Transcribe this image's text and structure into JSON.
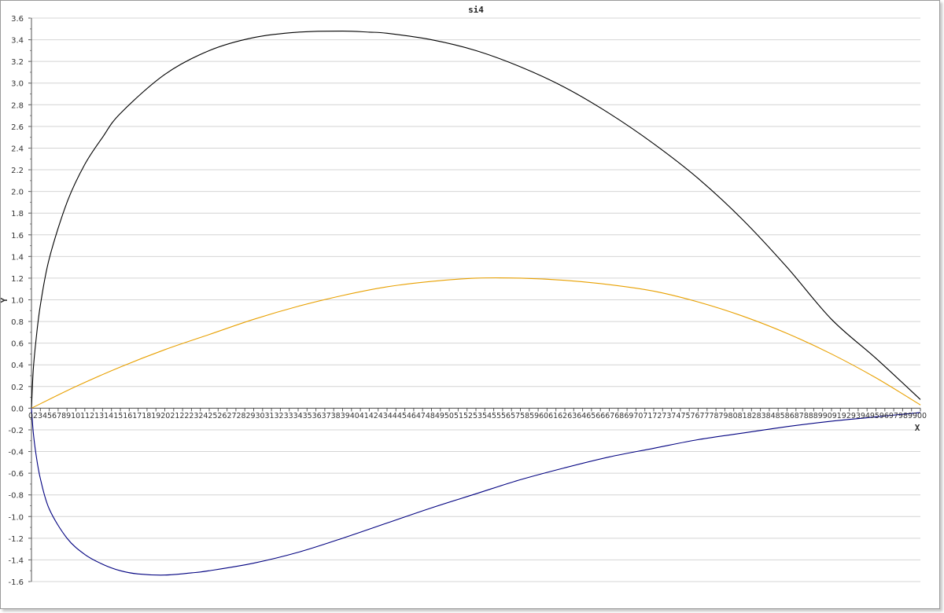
{
  "chart_data": {
    "type": "line",
    "title": "si4",
    "xlabel": "X",
    "ylabel": "Y",
    "xlim": [
      0,
      1
    ],
    "ylim": [
      -1.6,
      3.6
    ],
    "y_ticks": [
      "3.6",
      "3.4",
      "3.2",
      "3.0",
      "2.8",
      "2.6",
      "2.4",
      "2.2",
      "2.0",
      "1.8",
      "1.6",
      "1.4",
      "1.2",
      "1.0",
      "0.8",
      "0.6",
      "0.4",
      "0.2",
      "0.0",
      "-0.2",
      "-0.4",
      "-0.6",
      "-0.8",
      "-1.0",
      "-1.2",
      "-1.4",
      "-1.6"
    ],
    "x_tick_text": "0234567891011213141516171819202122232425262728293031323334353637383940414243444546474849505152535455565758596061626364656667686970717273747576777879808182838485868788899091929394959697989900",
    "grid": true,
    "series": [
      {
        "color": "#000000",
        "x": [
          0.0,
          0.002,
          0.005,
          0.01,
          0.02,
          0.04,
          0.06,
          0.08,
          0.1,
          0.15,
          0.2,
          0.25,
          0.3,
          0.35,
          0.38,
          0.4,
          0.45,
          0.5,
          0.55,
          0.6,
          0.65,
          0.7,
          0.75,
          0.8,
          0.85,
          0.9,
          0.95,
          1.0
        ],
        "y": [
          0.0,
          0.35,
          0.62,
          0.95,
          1.38,
          1.9,
          2.25,
          2.5,
          2.72,
          3.08,
          3.3,
          3.42,
          3.47,
          3.48,
          3.47,
          3.46,
          3.4,
          3.3,
          3.15,
          2.96,
          2.72,
          2.44,
          2.12,
          1.74,
          1.3,
          0.82,
          0.46,
          0.08
        ]
      },
      {
        "color": "#e8a000",
        "x": [
          0.0,
          0.05,
          0.1,
          0.15,
          0.2,
          0.25,
          0.3,
          0.35,
          0.4,
          0.45,
          0.5,
          0.55,
          0.6,
          0.65,
          0.7,
          0.75,
          0.8,
          0.85,
          0.9,
          0.95,
          1.0
        ],
        "y": [
          0.0,
          0.2,
          0.38,
          0.54,
          0.68,
          0.82,
          0.94,
          1.04,
          1.12,
          1.17,
          1.2,
          1.2,
          1.18,
          1.14,
          1.08,
          0.98,
          0.85,
          0.69,
          0.5,
          0.28,
          0.03
        ]
      },
      {
        "color": "#000080",
        "x": [
          0.0,
          0.002,
          0.005,
          0.01,
          0.02,
          0.04,
          0.06,
          0.08,
          0.1,
          0.12,
          0.15,
          0.18,
          0.2,
          0.25,
          0.3,
          0.35,
          0.4,
          0.45,
          0.5,
          0.55,
          0.6,
          0.65,
          0.7,
          0.75,
          0.8,
          0.85,
          0.9,
          0.95,
          1.0
        ],
        "y": [
          0.0,
          -0.22,
          -0.42,
          -0.65,
          -0.93,
          -1.2,
          -1.35,
          -1.44,
          -1.5,
          -1.53,
          -1.54,
          -1.52,
          -1.5,
          -1.43,
          -1.33,
          -1.2,
          -1.06,
          -0.92,
          -0.79,
          -0.66,
          -0.55,
          -0.45,
          -0.37,
          -0.29,
          -0.23,
          -0.17,
          -0.12,
          -0.08,
          -0.04
        ]
      }
    ]
  }
}
